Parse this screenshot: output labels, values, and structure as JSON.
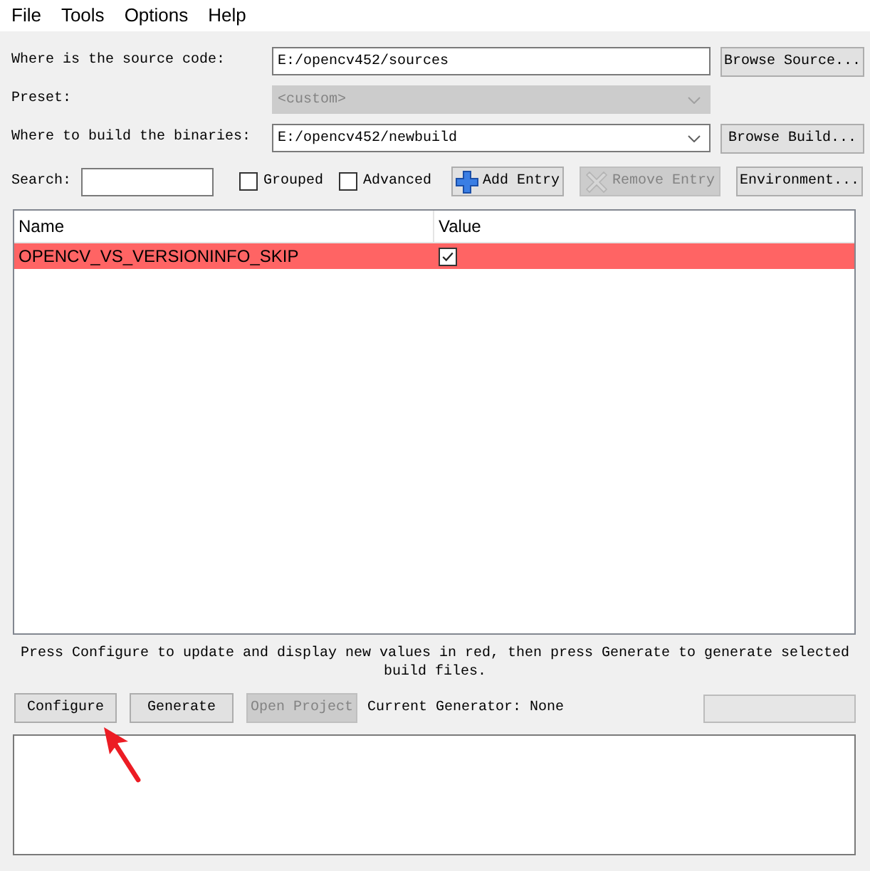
{
  "menu": [
    "File",
    "Tools",
    "Options",
    "Help"
  ],
  "source": {
    "label": "Where is the source code:",
    "value": "E:/opencv452/sources",
    "button": "Browse Source..."
  },
  "preset": {
    "label": "Preset:",
    "value": "<custom>",
    "disabled": true
  },
  "build": {
    "label": "Where to build the binaries:",
    "value": "E:/opencv452/newbuild",
    "button": "Browse Build..."
  },
  "search": {
    "label": "Search:"
  },
  "options": [
    {
      "label": "Grouped",
      "checked": false
    },
    {
      "label": "Advanced",
      "checked": false
    }
  ],
  "entry_buttons": [
    {
      "label": "Add Entry",
      "kind": "add",
      "disabled": false
    },
    {
      "label": "Remove Entry",
      "kind": "remove",
      "disabled": true
    },
    {
      "label": "Environment...",
      "kind": "plain",
      "disabled": false
    }
  ],
  "table": {
    "columns": [
      "Name",
      "Value"
    ],
    "rows": [
      {
        "name": "OPENCV_VS_VERSIONINFO_SKIP",
        "kind": "checkbox",
        "checked": true,
        "changed": true
      }
    ]
  },
  "hint": "Press Configure to update and display new values in red, then press Generate to generate selected build files.",
  "actions": [
    {
      "label": "Configure",
      "disabled": false
    },
    {
      "label": "Generate",
      "disabled": false
    },
    {
      "label": "Open Project",
      "disabled": true
    }
  ],
  "generator": "Current Generator: None",
  "progress": {
    "level": 0
  }
}
